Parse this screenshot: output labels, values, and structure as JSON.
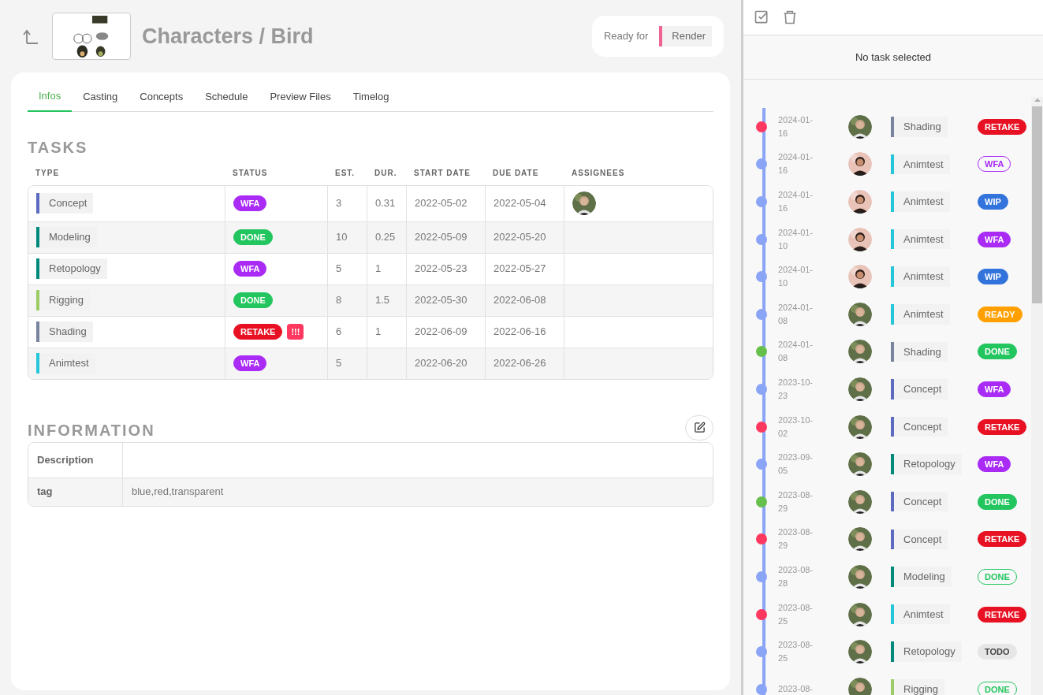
{
  "header": {
    "title": "Characters / Bird",
    "ready_label": "Ready for",
    "ready_task": {
      "name": "Render",
      "color": "#f06292"
    }
  },
  "tabs": [
    {
      "label": "Infos",
      "selected": true
    },
    {
      "label": "Casting",
      "selected": false
    },
    {
      "label": "Concepts",
      "selected": false
    },
    {
      "label": "Schedule",
      "selected": false
    },
    {
      "label": "Preview Files",
      "selected": false
    },
    {
      "label": "Timelog",
      "selected": false
    }
  ],
  "tasks": {
    "title": "TASKS",
    "columns": [
      "TYPE",
      "STATUS",
      "EST.",
      "DUR.",
      "START DATE",
      "DUE DATE",
      "ASSIGNEES"
    ],
    "rows": [
      {
        "type": {
          "name": "Concept",
          "color": "#5c6bc0"
        },
        "status": {
          "label": "WFA",
          "color": "#a92bf5"
        },
        "est": "3",
        "dur": "0.31",
        "start": "2022-05-02",
        "due": "2022-05-04",
        "assigned": true
      },
      {
        "type": {
          "name": "Modeling",
          "color": "#00897b"
        },
        "status": {
          "label": "DONE",
          "color": "#22c55e"
        },
        "est": "10",
        "dur": "0.25",
        "start": "2022-05-09",
        "due": "2022-05-20",
        "assigned": false
      },
      {
        "type": {
          "name": "Retopology",
          "color": "#00897b"
        },
        "status": {
          "label": "WFA",
          "color": "#a92bf5"
        },
        "est": "5",
        "dur": "1",
        "start": "2022-05-23",
        "due": "2022-05-27",
        "assigned": false
      },
      {
        "type": {
          "name": "Rigging",
          "color": "#9ccc65"
        },
        "status": {
          "label": "DONE",
          "color": "#22c55e"
        },
        "est": "8",
        "dur": "1.5",
        "start": "2022-05-30",
        "due": "2022-06-08",
        "assigned": false
      },
      {
        "type": {
          "name": "Shading",
          "color": "#78849e"
        },
        "status": {
          "label": "RETAKE",
          "color": "#e81123"
        },
        "priority": "!!!",
        "est": "6",
        "dur": "1",
        "start": "2022-06-09",
        "due": "2022-06-16",
        "assigned": false
      },
      {
        "type": {
          "name": "Animtest",
          "color": "#26c6da"
        },
        "status": {
          "label": "WFA",
          "color": "#a92bf5"
        },
        "est": "5",
        "start": "2022-06-20",
        "due": "2022-06-26",
        "assigned": false
      }
    ]
  },
  "information": {
    "title": "INFORMATION",
    "rows": [
      {
        "label": "Description"
      },
      {
        "label": "tag",
        "value": "blue,red,transparent"
      }
    ]
  },
  "panel": {
    "empty_text": "No task selected",
    "timeline": [
      {
        "date": "2024-01-16",
        "dot": {
          "color": "#ff3860"
        },
        "type": {
          "name": "Shading",
          "color": "#78849e"
        },
        "status": {
          "label": "RETAKE",
          "color": "#e81123",
          "outline": false
        }
      },
      {
        "date": "2024-01-16",
        "dot": {
          "color": "#8aa4f6"
        },
        "type": {
          "name": "Animtest",
          "color": "#26c6da"
        },
        "status": {
          "label": "WFA",
          "color": "#a92bf5",
          "outline": true
        }
      },
      {
        "date": "2024-01-16",
        "dot": {
          "color": "#8aa4f6"
        },
        "type": {
          "name": "Animtest",
          "color": "#26c6da"
        },
        "status": {
          "label": "WIP",
          "color": "#3273dc",
          "outline": false
        }
      },
      {
        "date": "2024-01-10",
        "dot": {
          "color": "#8aa4f6"
        },
        "type": {
          "name": "Animtest",
          "color": "#26c6da"
        },
        "status": {
          "label": "WFA",
          "color": "#a92bf5",
          "outline": false
        }
      },
      {
        "date": "2024-01-10",
        "dot": {
          "color": "#8aa4f6"
        },
        "type": {
          "name": "Animtest",
          "color": "#26c6da"
        },
        "status": {
          "label": "WIP",
          "color": "#3273dc",
          "outline": false
        }
      },
      {
        "date": "2024-01-08",
        "dot": {
          "color": "#8aa4f6"
        },
        "type": {
          "name": "Animtest",
          "color": "#26c6da"
        },
        "status": {
          "label": "READY",
          "color": "#ffa000",
          "outline": false
        }
      },
      {
        "date": "2024-01-08",
        "dot": {
          "color": "#67c04b"
        },
        "type": {
          "name": "Shading",
          "color": "#78849e"
        },
        "status": {
          "label": "DONE",
          "color": "#22c55e",
          "outline": false
        }
      },
      {
        "date": "2023-10-23",
        "dot": {
          "color": "#8aa4f6"
        },
        "type": {
          "name": "Concept",
          "color": "#5c6bc0"
        },
        "status": {
          "label": "WFA",
          "color": "#a92bf5",
          "outline": false
        }
      },
      {
        "date": "2023-10-02",
        "dot": {
          "color": "#ff3860"
        },
        "type": {
          "name": "Concept",
          "color": "#5c6bc0"
        },
        "status": {
          "label": "RETAKE",
          "color": "#e81123",
          "outline": false
        }
      },
      {
        "date": "2023-09-05",
        "dot": {
          "color": "#8aa4f6"
        },
        "type": {
          "name": "Retopology",
          "color": "#00897b"
        },
        "status": {
          "label": "WFA",
          "color": "#a92bf5",
          "outline": false
        }
      },
      {
        "date": "2023-08-29",
        "dot": {
          "color": "#67c04b"
        },
        "type": {
          "name": "Concept",
          "color": "#5c6bc0"
        },
        "status": {
          "label": "DONE",
          "color": "#22c55e",
          "outline": false
        }
      },
      {
        "date": "2023-08-29",
        "dot": {
          "color": "#ff3860"
        },
        "type": {
          "name": "Concept",
          "color": "#5c6bc0"
        },
        "status": {
          "label": "RETAKE",
          "color": "#e81123",
          "outline": false
        }
      },
      {
        "date": "2023-08-28",
        "dot": {
          "color": "#8aa4f6"
        },
        "type": {
          "name": "Modeling",
          "color": "#00897b"
        },
        "status": {
          "label": "DONE",
          "color": "#22c55e",
          "outline": true
        }
      },
      {
        "date": "2023-08-25",
        "dot": {
          "color": "#ff3860"
        },
        "type": {
          "name": "Animtest",
          "color": "#26c6da"
        },
        "status": {
          "label": "RETAKE",
          "color": "#e81123",
          "outline": false
        }
      },
      {
        "date": "2023-08-25",
        "dot": {
          "color": "#8aa4f6"
        },
        "type": {
          "name": "Retopology",
          "color": "#00897b"
        },
        "status": {
          "label": "TODO",
          "color": "#e6e6e6",
          "outline": false
        }
      },
      {
        "date": "2023-08-",
        "dot": {
          "color": "#8aa4f6"
        },
        "type": {
          "name": "Rigging",
          "color": "#9ccc65"
        },
        "status": {
          "label": "DONE",
          "color": "#22c55e",
          "outline": true
        }
      }
    ]
  }
}
